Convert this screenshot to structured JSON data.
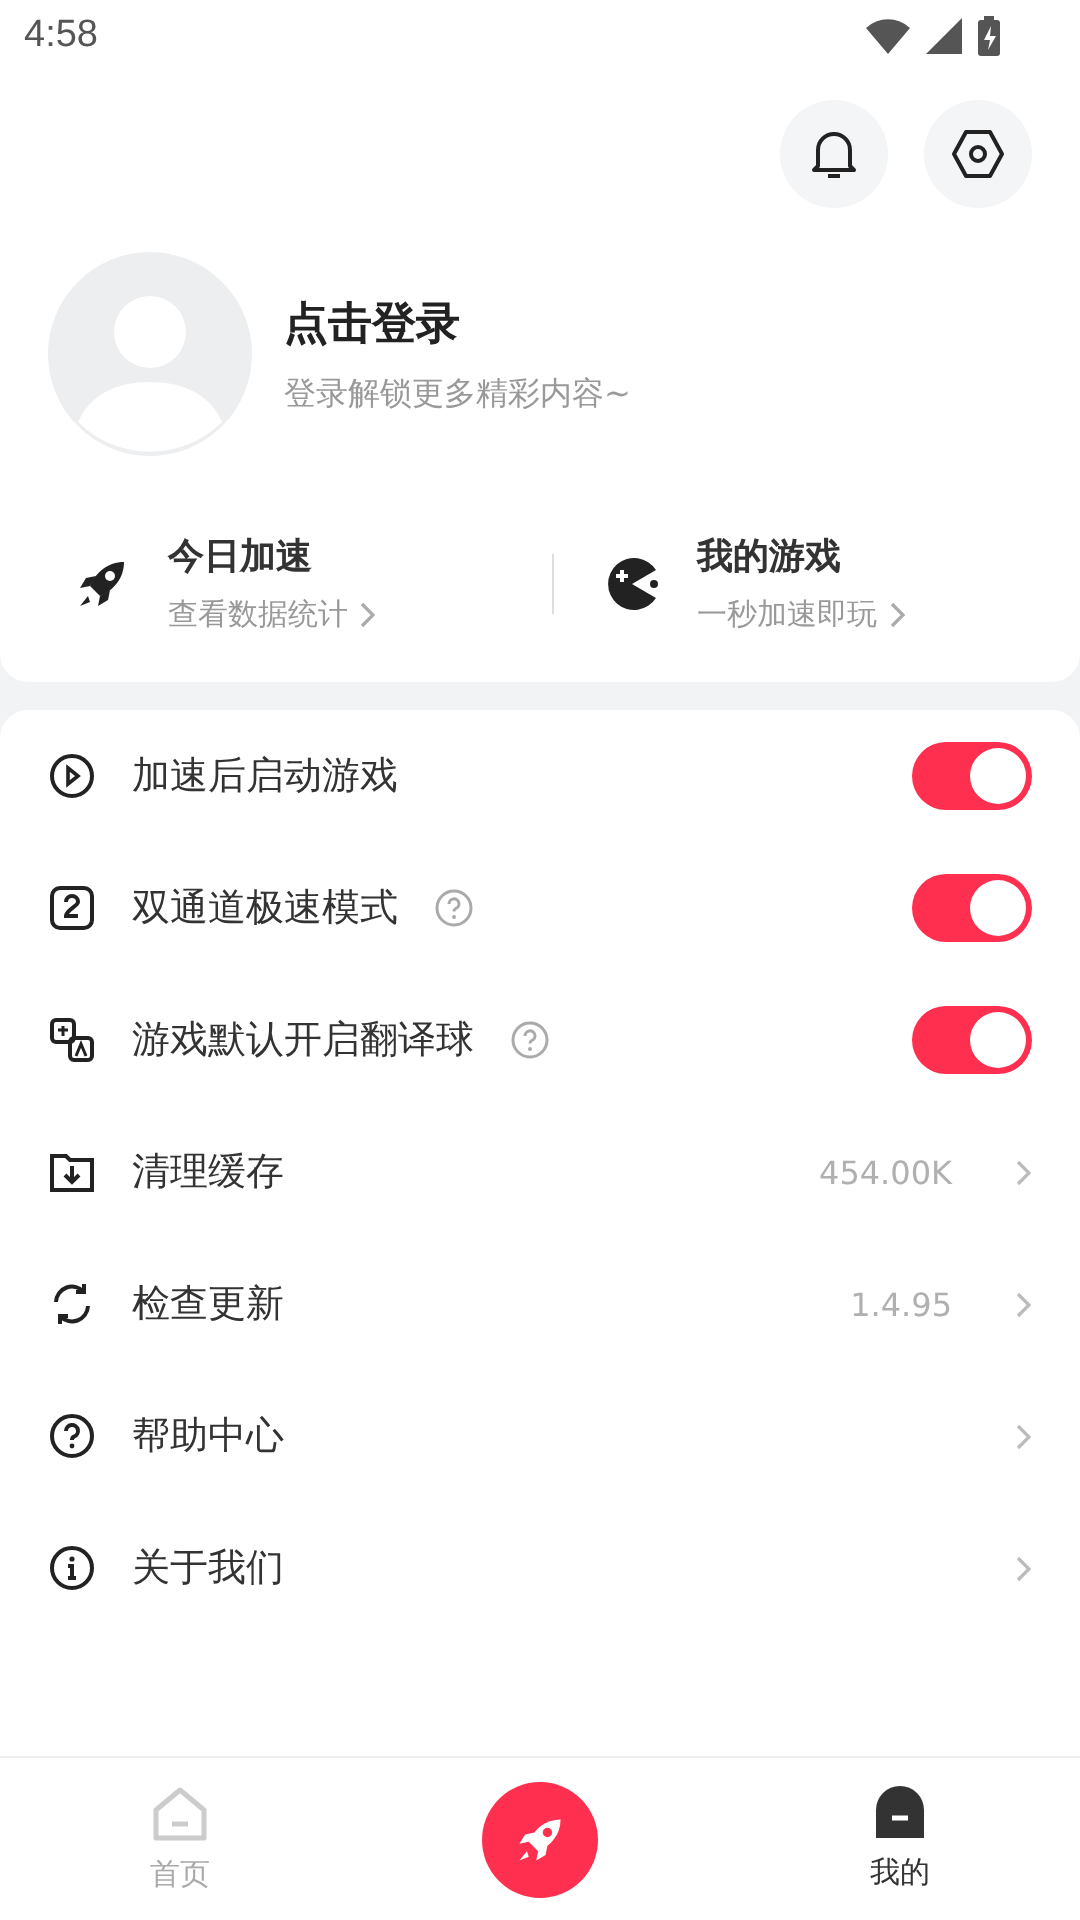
{
  "status_bar": {
    "time": "4:58"
  },
  "profile": {
    "title": "点击登录",
    "subtitle": "登录解锁更多精彩内容~"
  },
  "stats": [
    {
      "kind": "rocket",
      "title": "今日加速",
      "subtitle": "查看数据统计"
    },
    {
      "kind": "game",
      "title": "我的游戏",
      "subtitle": "一秒加速即玩"
    }
  ],
  "settings": [
    {
      "kind": "toggle",
      "label": "加速后启动游戏",
      "help": false,
      "on": true
    },
    {
      "kind": "toggle",
      "label": "双通道极速模式",
      "help": true,
      "on": true
    },
    {
      "kind": "toggle",
      "label": "游戏默认开启翻译球",
      "help": true,
      "on": true
    },
    {
      "kind": "link",
      "label": "清理缓存",
      "value": "454.00K"
    },
    {
      "kind": "link",
      "label": "检查更新",
      "value": "1.4.95"
    },
    {
      "kind": "link",
      "label": "帮助中心"
    },
    {
      "kind": "link",
      "label": "关于我们"
    }
  ],
  "bottom_nav": [
    {
      "kind": "tab",
      "label": "首页",
      "selected": false
    },
    {
      "kind": "center"
    },
    {
      "kind": "tab",
      "label": "我的",
      "selected": true
    }
  ]
}
